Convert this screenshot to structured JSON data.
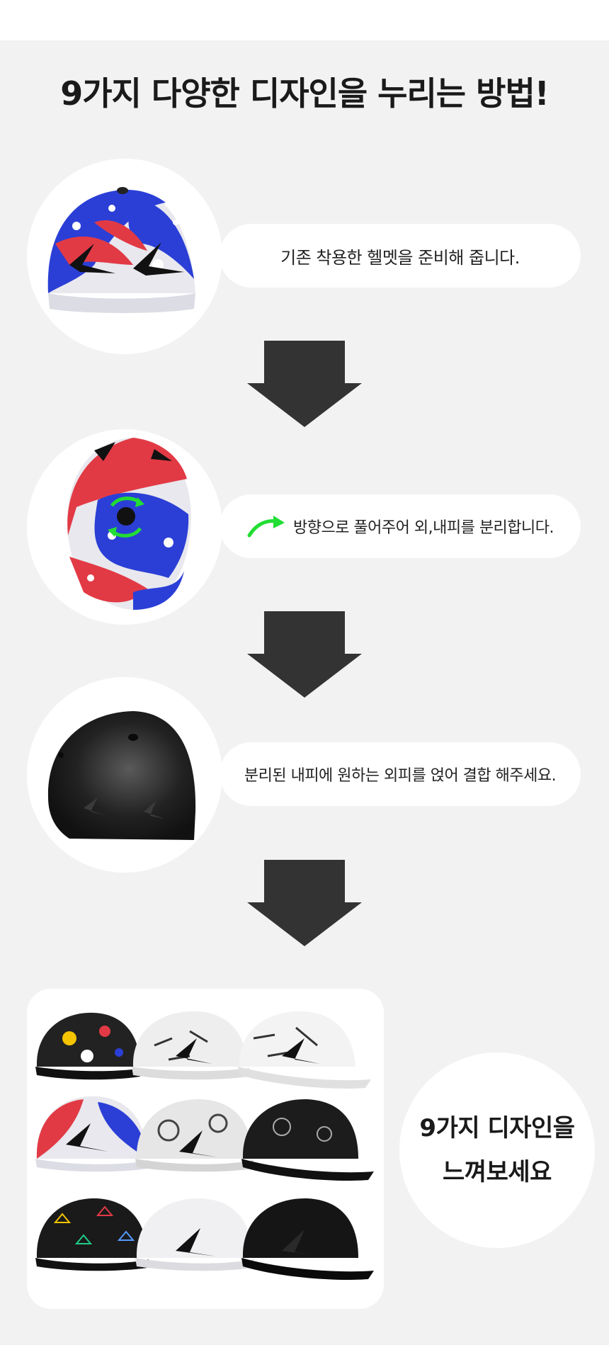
{
  "header": {
    "title": "9가지 다양한 디자인을 누리는 방법!"
  },
  "steps": [
    {
      "text": "기존 착용한 헬멧을 준비해 줍니다."
    },
    {
      "text": "방향으로 풀어주어 외,내피를 분리합니다."
    },
    {
      "text": "분리된 내피에 원하는 외피를 얹어 결합 해주세요."
    }
  ],
  "final": {
    "line1": "9가지 디자인을",
    "line2": "느껴보세요"
  },
  "colors": {
    "background": "#f2f2f2",
    "card": "#ffffff",
    "arrow": "#333333",
    "rotate_arrow": "#22dd33",
    "cap_blue": "#2b3fd6",
    "cap_red": "#e23a45",
    "cap_white": "#e8e8ee",
    "helmet_black": "#1c1c1c"
  },
  "icons": [
    "down-arrow-icon",
    "rotate-arrow-icon"
  ]
}
